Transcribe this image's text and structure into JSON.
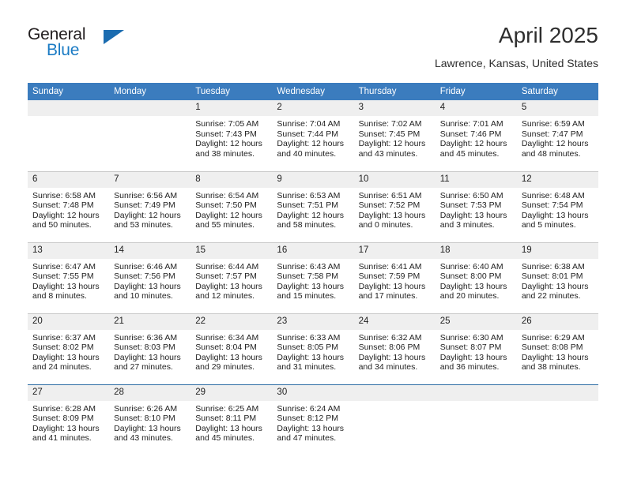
{
  "brand": {
    "name_part1": "General",
    "name_part2": "Blue",
    "triangle_color": "#1b6cb0",
    "blue_text_color": "#1b7bc4",
    "dark_text_color": "#231f20"
  },
  "header": {
    "title": "April 2025",
    "subtitle": "Lawrence, Kansas, United States"
  },
  "theme": {
    "header_bg": "#3b7cbe",
    "daynum_bg": "#efefef",
    "grid_line": "#c8c8c8",
    "accent_line": "#2e6da4"
  },
  "weekday_headers": [
    "Sunday",
    "Monday",
    "Tuesday",
    "Wednesday",
    "Thursday",
    "Friday",
    "Saturday"
  ],
  "weeks": [
    [
      {
        "day": "",
        "sunrise": "",
        "sunset": "",
        "daylight_line1": "",
        "daylight_line2": ""
      },
      {
        "day": "",
        "sunrise": "",
        "sunset": "",
        "daylight_line1": "",
        "daylight_line2": ""
      },
      {
        "day": "1",
        "sunrise": "Sunrise: 7:05 AM",
        "sunset": "Sunset: 7:43 PM",
        "daylight_line1": "Daylight: 12 hours",
        "daylight_line2": "and 38 minutes."
      },
      {
        "day": "2",
        "sunrise": "Sunrise: 7:04 AM",
        "sunset": "Sunset: 7:44 PM",
        "daylight_line1": "Daylight: 12 hours",
        "daylight_line2": "and 40 minutes."
      },
      {
        "day": "3",
        "sunrise": "Sunrise: 7:02 AM",
        "sunset": "Sunset: 7:45 PM",
        "daylight_line1": "Daylight: 12 hours",
        "daylight_line2": "and 43 minutes."
      },
      {
        "day": "4",
        "sunrise": "Sunrise: 7:01 AM",
        "sunset": "Sunset: 7:46 PM",
        "daylight_line1": "Daylight: 12 hours",
        "daylight_line2": "and 45 minutes."
      },
      {
        "day": "5",
        "sunrise": "Sunrise: 6:59 AM",
        "sunset": "Sunset: 7:47 PM",
        "daylight_line1": "Daylight: 12 hours",
        "daylight_line2": "and 48 minutes."
      }
    ],
    [
      {
        "day": "6",
        "sunrise": "Sunrise: 6:58 AM",
        "sunset": "Sunset: 7:48 PM",
        "daylight_line1": "Daylight: 12 hours",
        "daylight_line2": "and 50 minutes."
      },
      {
        "day": "7",
        "sunrise": "Sunrise: 6:56 AM",
        "sunset": "Sunset: 7:49 PM",
        "daylight_line1": "Daylight: 12 hours",
        "daylight_line2": "and 53 minutes."
      },
      {
        "day": "8",
        "sunrise": "Sunrise: 6:54 AM",
        "sunset": "Sunset: 7:50 PM",
        "daylight_line1": "Daylight: 12 hours",
        "daylight_line2": "and 55 minutes."
      },
      {
        "day": "9",
        "sunrise": "Sunrise: 6:53 AM",
        "sunset": "Sunset: 7:51 PM",
        "daylight_line1": "Daylight: 12 hours",
        "daylight_line2": "and 58 minutes."
      },
      {
        "day": "10",
        "sunrise": "Sunrise: 6:51 AM",
        "sunset": "Sunset: 7:52 PM",
        "daylight_line1": "Daylight: 13 hours",
        "daylight_line2": "and 0 minutes."
      },
      {
        "day": "11",
        "sunrise": "Sunrise: 6:50 AM",
        "sunset": "Sunset: 7:53 PM",
        "daylight_line1": "Daylight: 13 hours",
        "daylight_line2": "and 3 minutes."
      },
      {
        "day": "12",
        "sunrise": "Sunrise: 6:48 AM",
        "sunset": "Sunset: 7:54 PM",
        "daylight_line1": "Daylight: 13 hours",
        "daylight_line2": "and 5 minutes."
      }
    ],
    [
      {
        "day": "13",
        "sunrise": "Sunrise: 6:47 AM",
        "sunset": "Sunset: 7:55 PM",
        "daylight_line1": "Daylight: 13 hours",
        "daylight_line2": "and 8 minutes."
      },
      {
        "day": "14",
        "sunrise": "Sunrise: 6:46 AM",
        "sunset": "Sunset: 7:56 PM",
        "daylight_line1": "Daylight: 13 hours",
        "daylight_line2": "and 10 minutes."
      },
      {
        "day": "15",
        "sunrise": "Sunrise: 6:44 AM",
        "sunset": "Sunset: 7:57 PM",
        "daylight_line1": "Daylight: 13 hours",
        "daylight_line2": "and 12 minutes."
      },
      {
        "day": "16",
        "sunrise": "Sunrise: 6:43 AM",
        "sunset": "Sunset: 7:58 PM",
        "daylight_line1": "Daylight: 13 hours",
        "daylight_line2": "and 15 minutes."
      },
      {
        "day": "17",
        "sunrise": "Sunrise: 6:41 AM",
        "sunset": "Sunset: 7:59 PM",
        "daylight_line1": "Daylight: 13 hours",
        "daylight_line2": "and 17 minutes."
      },
      {
        "day": "18",
        "sunrise": "Sunrise: 6:40 AM",
        "sunset": "Sunset: 8:00 PM",
        "daylight_line1": "Daylight: 13 hours",
        "daylight_line2": "and 20 minutes."
      },
      {
        "day": "19",
        "sunrise": "Sunrise: 6:38 AM",
        "sunset": "Sunset: 8:01 PM",
        "daylight_line1": "Daylight: 13 hours",
        "daylight_line2": "and 22 minutes."
      }
    ],
    [
      {
        "day": "20",
        "sunrise": "Sunrise: 6:37 AM",
        "sunset": "Sunset: 8:02 PM",
        "daylight_line1": "Daylight: 13 hours",
        "daylight_line2": "and 24 minutes."
      },
      {
        "day": "21",
        "sunrise": "Sunrise: 6:36 AM",
        "sunset": "Sunset: 8:03 PM",
        "daylight_line1": "Daylight: 13 hours",
        "daylight_line2": "and 27 minutes."
      },
      {
        "day": "22",
        "sunrise": "Sunrise: 6:34 AM",
        "sunset": "Sunset: 8:04 PM",
        "daylight_line1": "Daylight: 13 hours",
        "daylight_line2": "and 29 minutes."
      },
      {
        "day": "23",
        "sunrise": "Sunrise: 6:33 AM",
        "sunset": "Sunset: 8:05 PM",
        "daylight_line1": "Daylight: 13 hours",
        "daylight_line2": "and 31 minutes."
      },
      {
        "day": "24",
        "sunrise": "Sunrise: 6:32 AM",
        "sunset": "Sunset: 8:06 PM",
        "daylight_line1": "Daylight: 13 hours",
        "daylight_line2": "and 34 minutes."
      },
      {
        "day": "25",
        "sunrise": "Sunrise: 6:30 AM",
        "sunset": "Sunset: 8:07 PM",
        "daylight_line1": "Daylight: 13 hours",
        "daylight_line2": "and 36 minutes."
      },
      {
        "day": "26",
        "sunrise": "Sunrise: 6:29 AM",
        "sunset": "Sunset: 8:08 PM",
        "daylight_line1": "Daylight: 13 hours",
        "daylight_line2": "and 38 minutes."
      }
    ],
    [
      {
        "day": "27",
        "sunrise": "Sunrise: 6:28 AM",
        "sunset": "Sunset: 8:09 PM",
        "daylight_line1": "Daylight: 13 hours",
        "daylight_line2": "and 41 minutes."
      },
      {
        "day": "28",
        "sunrise": "Sunrise: 6:26 AM",
        "sunset": "Sunset: 8:10 PM",
        "daylight_line1": "Daylight: 13 hours",
        "daylight_line2": "and 43 minutes."
      },
      {
        "day": "29",
        "sunrise": "Sunrise: 6:25 AM",
        "sunset": "Sunset: 8:11 PM",
        "daylight_line1": "Daylight: 13 hours",
        "daylight_line2": "and 45 minutes."
      },
      {
        "day": "30",
        "sunrise": "Sunrise: 6:24 AM",
        "sunset": "Sunset: 8:12 PM",
        "daylight_line1": "Daylight: 13 hours",
        "daylight_line2": "and 47 minutes."
      },
      {
        "day": "",
        "sunrise": "",
        "sunset": "",
        "daylight_line1": "",
        "daylight_line2": ""
      },
      {
        "day": "",
        "sunrise": "",
        "sunset": "",
        "daylight_line1": "",
        "daylight_line2": ""
      },
      {
        "day": "",
        "sunrise": "",
        "sunset": "",
        "daylight_line1": "",
        "daylight_line2": ""
      }
    ]
  ]
}
